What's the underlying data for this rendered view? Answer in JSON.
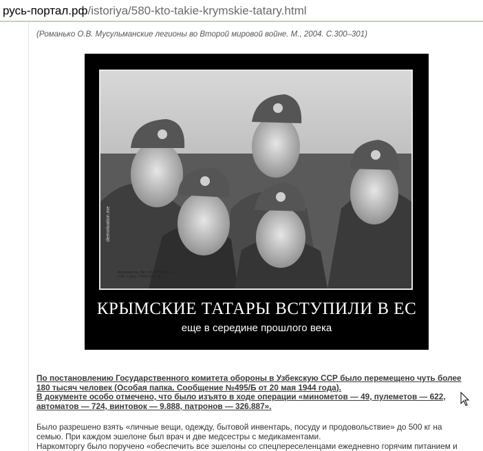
{
  "address_bar": {
    "domain": "русь-портал.рф",
    "path": "/istoriya/580-kto-takie-krymskie-tatary.html"
  },
  "article": {
    "citation": "(Романько О.В. Мусульманские легионы во Второй мировой войне. М., 2004. С.300–301)",
    "poster": {
      "watermark": "demotivation.me",
      "archive_caption": "Bundesarchiv, Bild 146-1973-118-11\nFoto: o.Ang. | 1943/1944 ca.",
      "headline": "КРЫМСКИЕ ТАТАРЫ ВСТУПИЛИ В ЕС",
      "subline": "еще в середине прошлого века"
    },
    "paragraph1_lines": [
      "По постановлению Государственного комитета обороны в Узбекскую ССР было перемещено чуть более",
      "180 тысяч человек (Особая папка. Сообщение №495/Б от 20 мая 1944 года).",
      "В документе особо отмечено, что было изъято в ходе операции «минометов — 49, пулеметов — 622,",
      "автоматов — 724, винтовок — 9.888, патронов — 326.887»."
    ],
    "paragraph2_lines": [
      "Было разрешено взять «личные вещи, одежду, бытовой инвентарь, посуду и продовольствие» до 500 кг на",
      "семью. При каждом эшелоне был врач и две медсестры с медикаментами.",
      "Наркомторгу было поручено «обеспечить все эшелоны со спецпереселенцами ежедневно горячим питанием и"
    ]
  },
  "colors": {
    "url_domain": "#000000",
    "url_path": "#6a6a6a",
    "address_border": "#b9d9a8",
    "poster_background": "#000000"
  },
  "icons": [
    "mouse-cursor-icon"
  ]
}
